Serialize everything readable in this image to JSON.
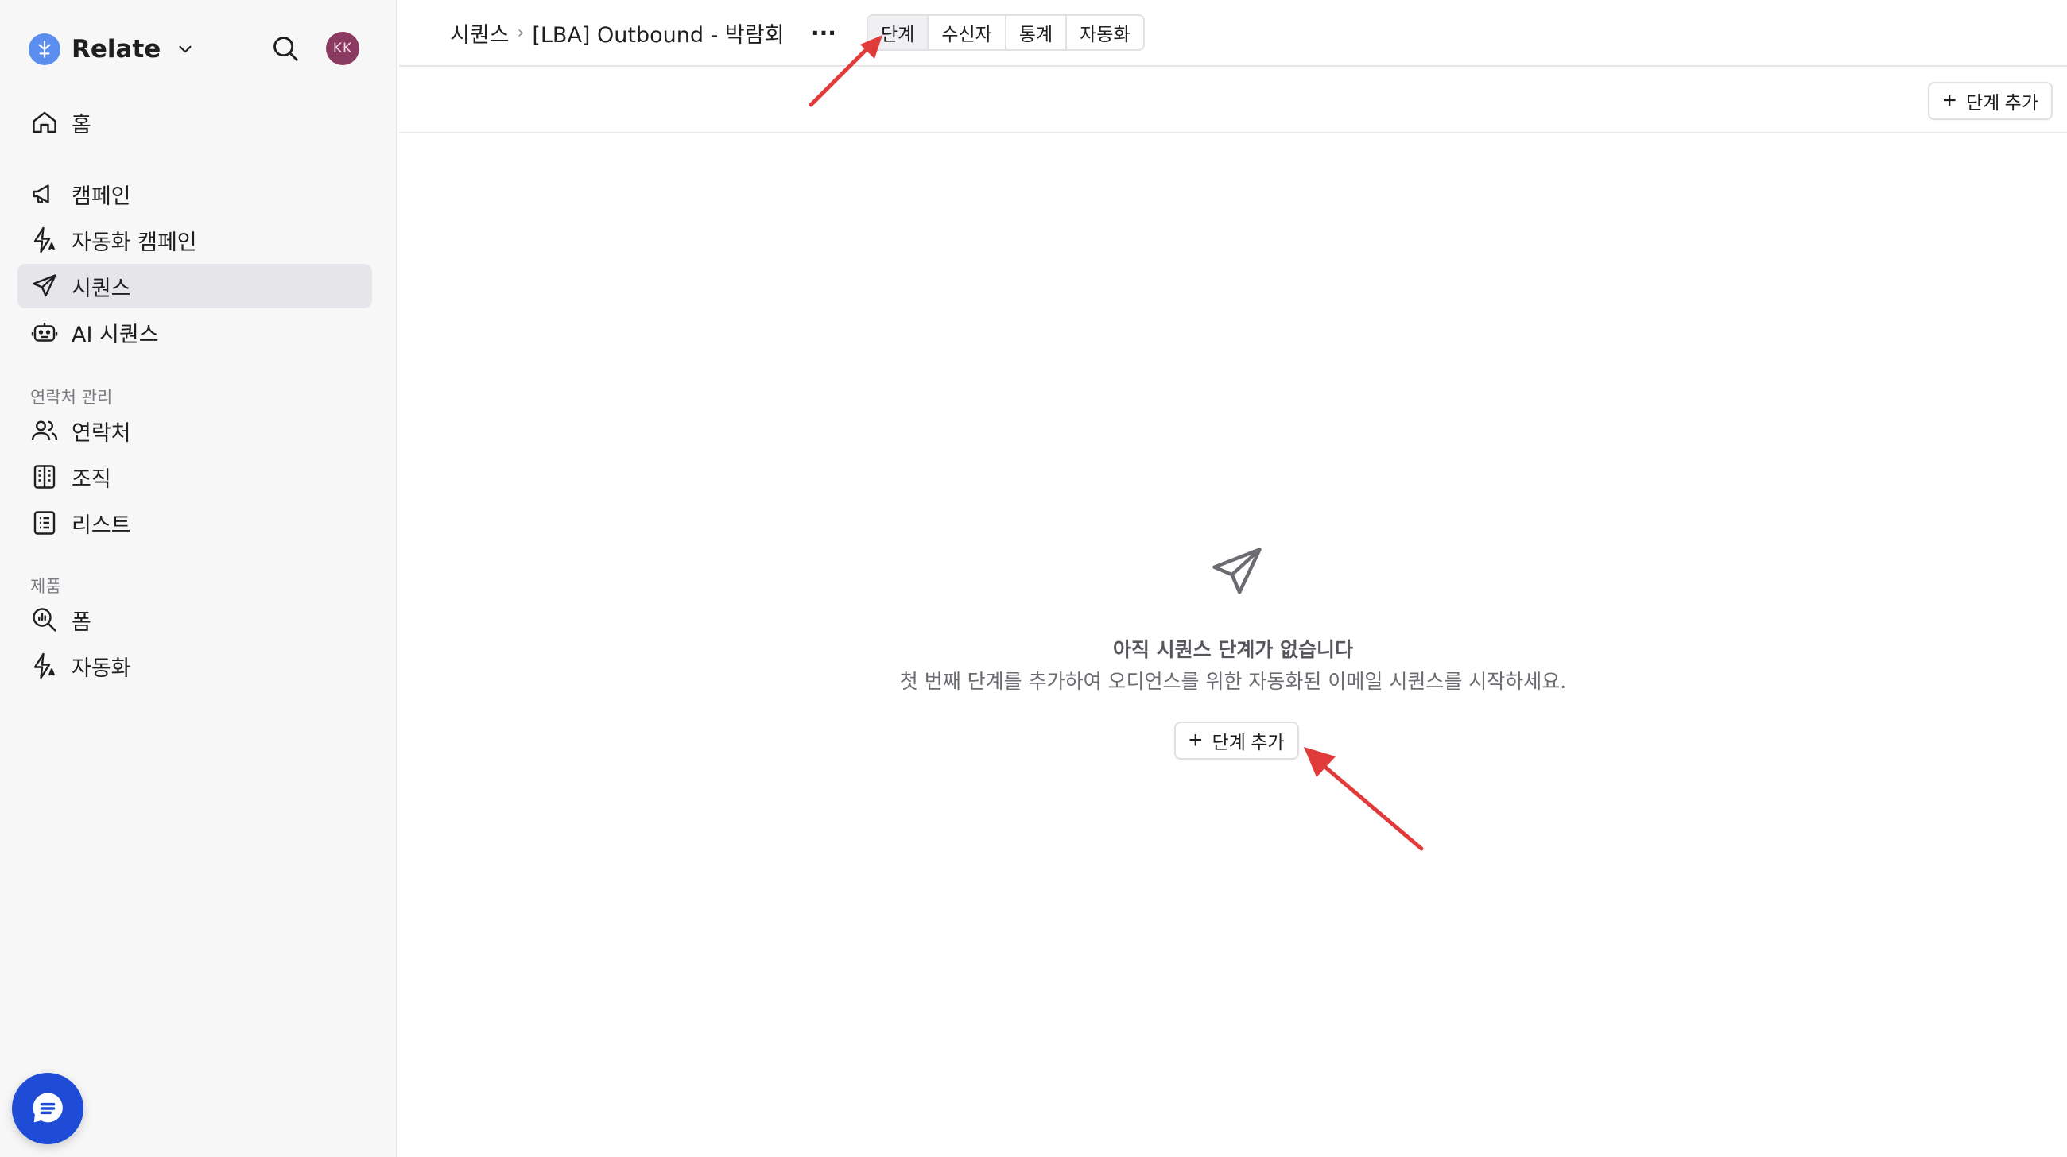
{
  "app": {
    "name": "Relate",
    "avatar_initials": "KK",
    "brand_color": "#5b8def",
    "avatar_color": "#8b3a62"
  },
  "sidebar": {
    "home": "홈",
    "campaign": "캠페인",
    "auto_campaign": "자동화 캠페인",
    "sequence": "시퀀스",
    "ai_sequence": "AI 시퀀스",
    "contacts_section": "연락처 관리",
    "contacts": "연락처",
    "organizations": "조직",
    "lists": "리스트",
    "product_section": "제품",
    "forms": "폼",
    "automation": "자동화",
    "active_item": "시퀀스"
  },
  "header": {
    "breadcrumb_root": "시퀀스",
    "breadcrumb_separator": "›",
    "breadcrumb_current": "[LBA] Outbound - 박람회",
    "more": "···",
    "tabs": [
      "단계",
      "수신자",
      "통계",
      "자동화"
    ],
    "active_tab": "단계"
  },
  "toolbar": {
    "add_step_label": "단계 추가"
  },
  "empty_state": {
    "title": "아직 시퀀스 단계가 없습니다",
    "description": "첫 번째 단계를 추가하여 오디언스를 위한 자동화된 이메일 시퀀스를 시작하세요.",
    "add_step_label": "단계 추가"
  },
  "annotations": {
    "arrow_color": "#e03a3a"
  }
}
